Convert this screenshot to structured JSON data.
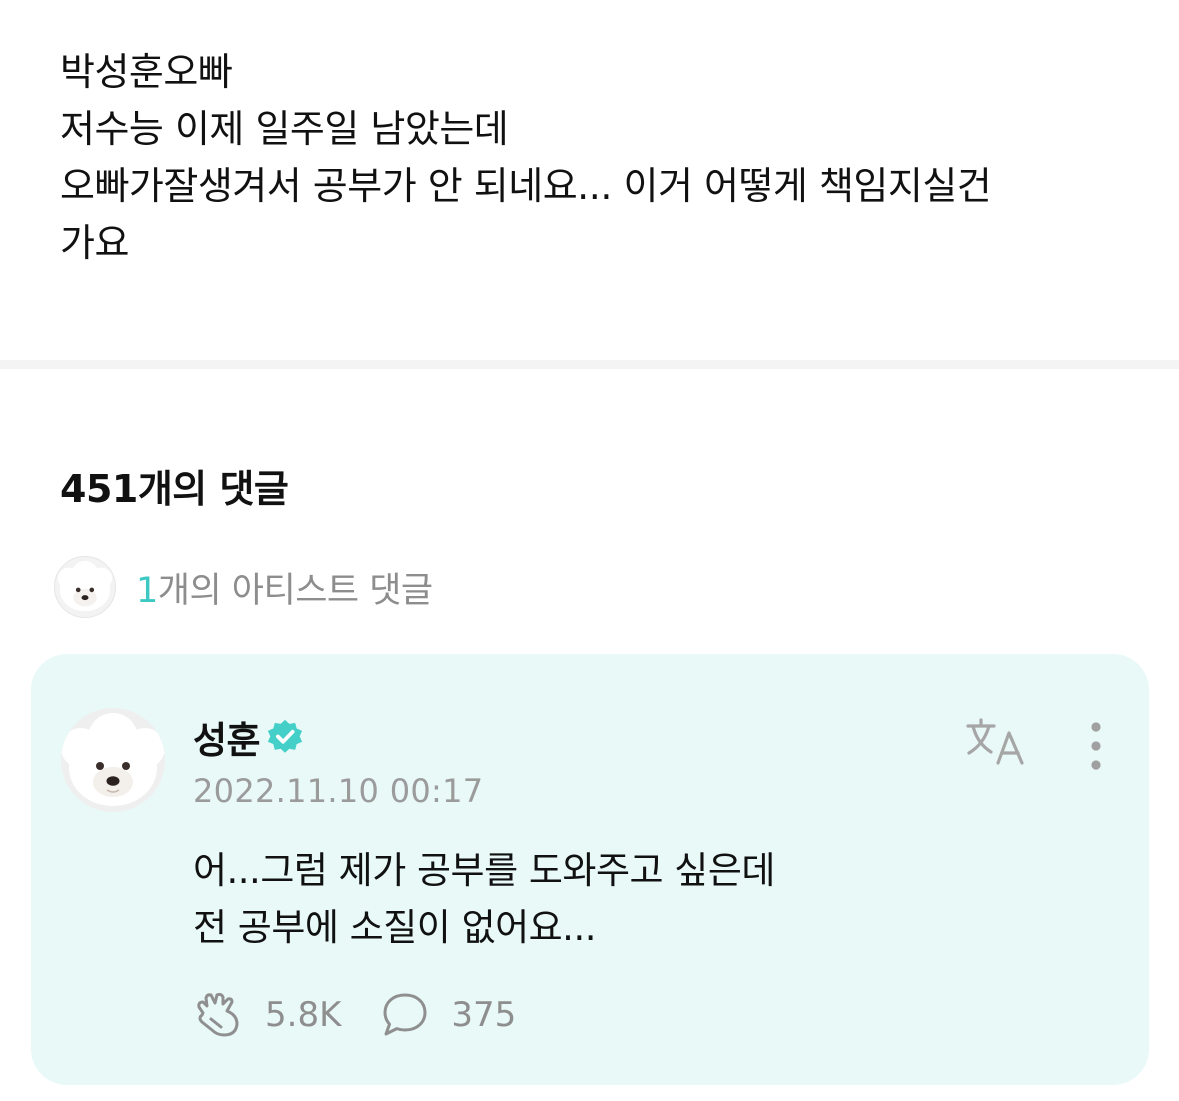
{
  "post": {
    "lines": [
      "박성훈오빠",
      "저수능 이제 일주일 남았는데",
      "오빠가잘생겨서 공부가 안 되네요... 이거 어떻게 책임지실건",
      "가요"
    ]
  },
  "comments_header": {
    "count_label": "451개의 댓글"
  },
  "artist_comments": {
    "count": "1",
    "label": "개의 아티스트 댓글"
  },
  "comment": {
    "author": "성훈",
    "timestamp": "2022.11.10 00:17",
    "lines": [
      "어...그럼 제가 공부를 도와주고 싶은데",
      "전 공부에 소질이 없어요..."
    ],
    "likes": "5.8K",
    "replies": "375"
  },
  "icons": {
    "verified": "verified-badge-icon",
    "translate": "translate-icon",
    "more": "more-vertical-icon",
    "like": "cheer-hand-icon",
    "reply": "speech-bubble-icon"
  },
  "colors": {
    "accent": "#3cc9c4",
    "card_background": "#e8f9f7",
    "muted_text": "#9b9b9b"
  }
}
